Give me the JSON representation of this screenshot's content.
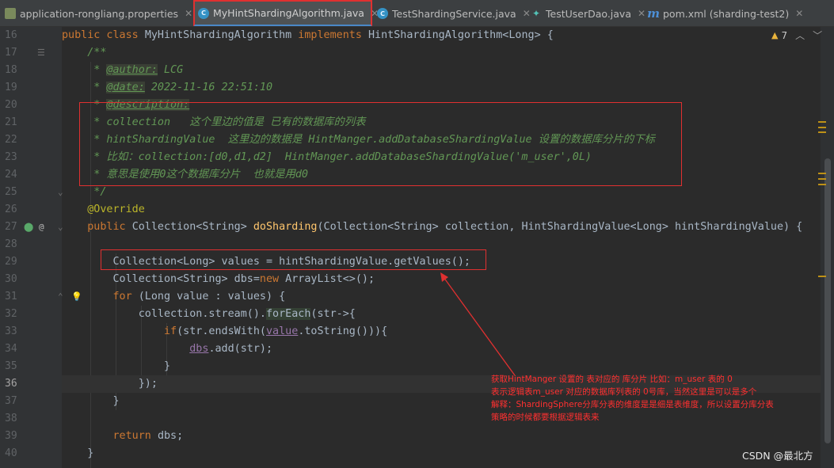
{
  "tabs": [
    {
      "label": "application-rongliang.properties",
      "icon": "properties-file-icon",
      "active": false,
      "width": 244
    },
    {
      "label": "MyHintShardingAlgorithm.java",
      "icon": "java-class-icon",
      "active": true,
      "width": 226
    },
    {
      "label": "TestShardingService.java",
      "icon": "java-class-icon",
      "active": false,
      "width": 194
    },
    {
      "label": "TestUserDao.java",
      "icon": "dao-interface-icon",
      "active": false,
      "width": 148
    },
    {
      "label": "pom.xml (sharding-test2)",
      "icon": "maven-icon",
      "active": false,
      "width": 190
    }
  ],
  "inspection": {
    "count": "7"
  },
  "lines": [
    {
      "n": "16",
      "segs": [
        [
          "kw",
          "public class "
        ],
        [
          "",
          "MyHintShardingAlgorithm "
        ],
        [
          "kw",
          "implements "
        ],
        [
          "",
          "HintShardingAlgorithm<Long> {"
        ]
      ]
    },
    {
      "n": "17",
      "segs": [
        [
          "cm",
          "    /**"
        ]
      ]
    },
    {
      "n": "18",
      "segs": [
        [
          "cm",
          "     * "
        ],
        [
          "tag",
          "@author:"
        ],
        [
          "cm",
          " LCG"
        ]
      ]
    },
    {
      "n": "19",
      "segs": [
        [
          "cm",
          "     * "
        ],
        [
          "tag",
          "@date:"
        ],
        [
          "cm",
          " 2022-11-16 22:51:10"
        ]
      ]
    },
    {
      "n": "20",
      "segs": [
        [
          "cm",
          "     * "
        ],
        [
          "tag",
          "@description:"
        ]
      ]
    },
    {
      "n": "21",
      "segs": [
        [
          "cm",
          "     * collection   这个里边的值是 已有的数据库的列表"
        ]
      ]
    },
    {
      "n": "22",
      "segs": [
        [
          "cm",
          "     * hintShardingValue  这里边的数据是 HintManger.addDatabaseShardingValue 设置的数据库分片的下标"
        ]
      ]
    },
    {
      "n": "23",
      "segs": [
        [
          "cm",
          "     * 比如：collection:[d0,d1,d2]  HintManger.addDatabaseShardingValue('m_user',0L)"
        ]
      ]
    },
    {
      "n": "24",
      "segs": [
        [
          "cm",
          "     * 意思是使用0这个数据库分片  也就是用d0"
        ]
      ]
    },
    {
      "n": "25",
      "segs": [
        [
          "cm",
          "     */"
        ]
      ]
    },
    {
      "n": "26",
      "segs": [
        [
          "ann",
          "    @Override"
        ]
      ]
    },
    {
      "n": "27",
      "segs": [
        [
          "kw",
          "    public "
        ],
        [
          "",
          "Collection<String> "
        ],
        [
          "fn",
          "doSharding"
        ],
        [
          "",
          "(Collection<String> collection, HintShardingValue<Long> hintShardingValue) {"
        ]
      ]
    },
    {
      "n": "28",
      "segs": []
    },
    {
      "n": "29",
      "segs": [
        [
          "",
          "        Collection<Long> values = hintShardingValue.getValues();"
        ]
      ]
    },
    {
      "n": "30",
      "segs": [
        [
          "",
          "        Collection<String> dbs="
        ],
        [
          "kw",
          "new "
        ],
        [
          "",
          "ArrayList<>();"
        ]
      ]
    },
    {
      "n": "31",
      "segs": [
        [
          "kw",
          "        for "
        ],
        [
          "",
          "(Long value : values) {"
        ]
      ]
    },
    {
      "n": "32",
      "segs": [
        [
          "",
          "            collection.stream()."
        ],
        [
          "hl",
          "forEach"
        ],
        [
          "",
          "(str->{"
        ]
      ]
    },
    {
      "n": "33",
      "segs": [
        [
          "kw",
          "                if"
        ],
        [
          "",
          "(str.endsWith("
        ],
        [
          "fld",
          "value"
        ],
        [
          "",
          ".toString())){"
        ]
      ]
    },
    {
      "n": "34",
      "segs": [
        [
          "",
          "                    "
        ],
        [
          "fld",
          "dbs"
        ],
        [
          "",
          ".add(str);"
        ]
      ]
    },
    {
      "n": "35",
      "segs": [
        [
          "",
          "                }"
        ]
      ]
    },
    {
      "n": "36",
      "segs": [
        [
          "",
          "            });"
        ]
      ],
      "current": true
    },
    {
      "n": "37",
      "segs": [
        [
          "",
          "        }"
        ]
      ]
    },
    {
      "n": "38",
      "segs": []
    },
    {
      "n": "39",
      "segs": [
        [
          "kw",
          "        return "
        ],
        [
          "",
          "dbs;"
        ]
      ]
    },
    {
      "n": "40",
      "segs": [
        [
          "",
          "    }"
        ]
      ]
    }
  ],
  "annotation": {
    "lines": [
      "获取HintManger 设置的 表对应的 库分片  比如：m_user   表的   0",
      "表示逻辑表m_user 对应的数据库列表的 0号库，当然这里是可以是多个",
      "解释：ShardingSphere分库分表的维度是是细是表维度，所以设置分库分表",
      "策略的时候都要根据逻辑表来"
    ]
  },
  "watermark": "CSDN @最北方"
}
